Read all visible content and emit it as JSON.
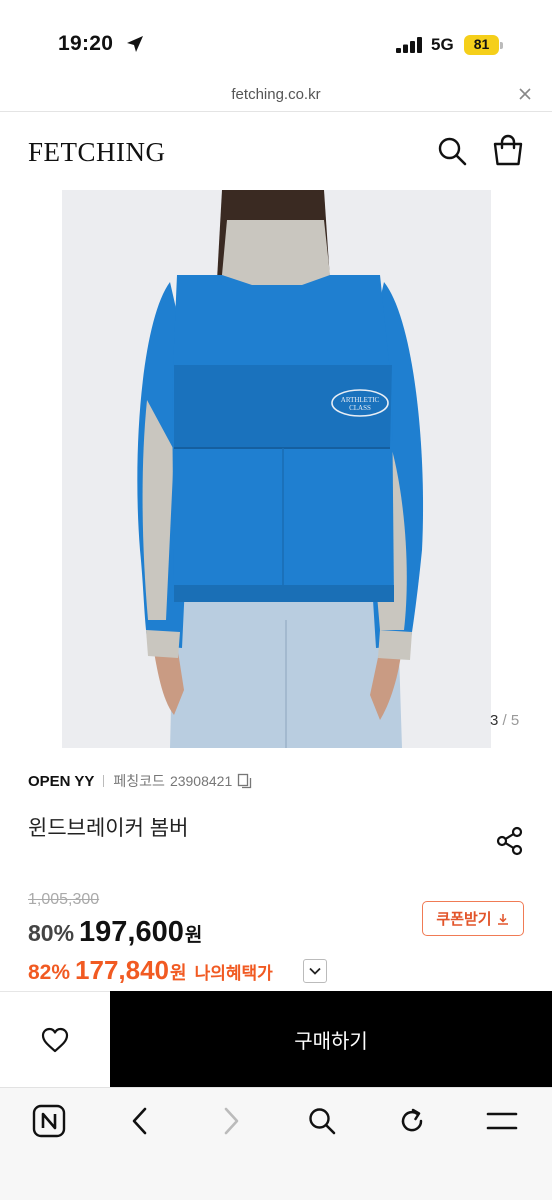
{
  "status": {
    "time": "19:20",
    "network": "5G",
    "battery": "81"
  },
  "browser": {
    "url": "fetching.co.kr"
  },
  "header": {
    "logo": "FETCHING"
  },
  "gallery": {
    "current": "3",
    "separator": "/",
    "total": "5",
    "print_text": "ARTHLETIC CLASS"
  },
  "product": {
    "brand": "OPEN YY",
    "code_label": "페칭코드",
    "code": "23908421",
    "name": "윈드브레이커 봄버",
    "original_price": "1,005,300",
    "discount": "80%",
    "price": "197,600",
    "currency": "원",
    "my_discount": "82%",
    "my_price": "177,840",
    "my_currency": "원",
    "benefit_label": "나의혜택가",
    "coupon_label": "쿠폰받기"
  },
  "purchase": {
    "buy_label": "구매하기"
  },
  "colors": {
    "accent": "#f15a22",
    "buy_bg": "#000000",
    "jacket_blue": "#1f7fd0",
    "jacket_grey": "#c9c6bf",
    "battery": "#f5cf1a"
  }
}
